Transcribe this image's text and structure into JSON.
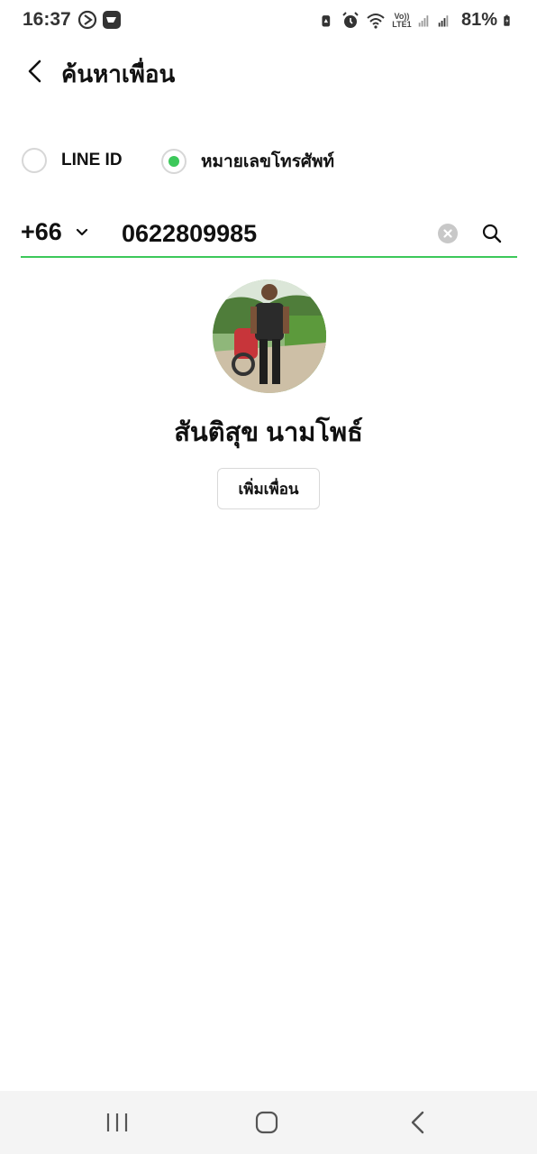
{
  "status_bar": {
    "time": "16:37",
    "battery_percent": "81%",
    "network_label": "Vo)) LTE1",
    "icons": [
      "screen-recorder-icon",
      "app-notification-icon",
      "data-saver-icon",
      "alarm-icon",
      "wifi-icon",
      "signal-icon",
      "signal-icon",
      "battery-charging-icon"
    ]
  },
  "header": {
    "title": "ค้นหาเพื่อน",
    "back_icon": "chevron-left-icon"
  },
  "search_type": {
    "options": [
      {
        "label": "LINE ID",
        "selected": false
      },
      {
        "label": "หมายเลขโทรศัพท์",
        "selected": true
      }
    ]
  },
  "phone_search": {
    "country_code": "+66",
    "value": "0622809985",
    "clear_icon": "clear-circle-icon",
    "search_icon": "search-icon"
  },
  "result": {
    "name": "สันติสุข  นามโพธ์",
    "add_button_label": "เพิ่มเพื่อน"
  },
  "colors": {
    "accent": "#3cc85a",
    "nav_background": "#f4f4f4"
  },
  "navigation_bar": {
    "buttons": [
      "recent-apps-icon",
      "home-icon",
      "back-icon"
    ]
  }
}
